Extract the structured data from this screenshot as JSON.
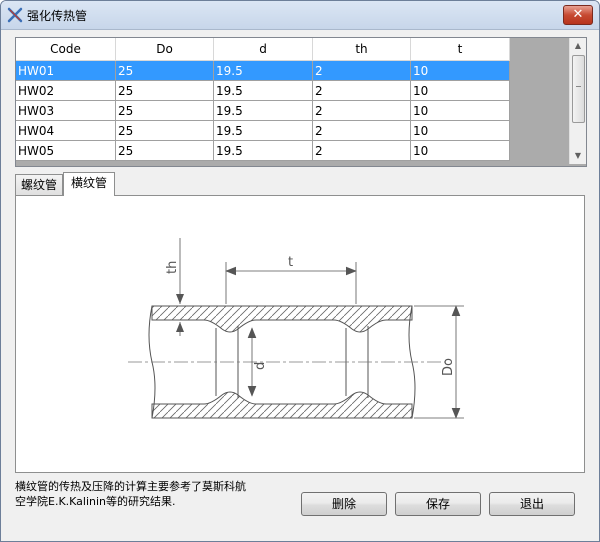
{
  "window": {
    "title": "强化传热管",
    "close_label": "✕"
  },
  "grid": {
    "columns": [
      "Code",
      "Do",
      "d",
      "th",
      "t"
    ],
    "rows": [
      [
        "HW01",
        "25",
        "19.5",
        "2",
        "10"
      ],
      [
        "HW02",
        "25",
        "19.5",
        "2",
        "10"
      ],
      [
        "HW03",
        "25",
        "19.5",
        "2",
        "10"
      ],
      [
        "HW04",
        "25",
        "19.5",
        "2",
        "10"
      ],
      [
        "HW05",
        "25",
        "19.5",
        "2",
        "10"
      ]
    ],
    "selected_row": 0,
    "scroll_up": "▲",
    "scroll_down": "▼"
  },
  "tabs": [
    {
      "label": "螺纹管",
      "active": false
    },
    {
      "label": "横纹管",
      "active": true
    }
  ],
  "diagram": {
    "labels": {
      "th": "th",
      "t": "t",
      "d": "d",
      "Do": "Do"
    }
  },
  "description": "横纹管的传热及压降的计算主要参考了莫斯科航空学院E.K.Kalinin等的研究结果.",
  "buttons": {
    "delete": "删除",
    "save": "保存",
    "exit": "退出"
  },
  "colors": {
    "selection": "#3399ff",
    "close_button": "#c74a32"
  }
}
